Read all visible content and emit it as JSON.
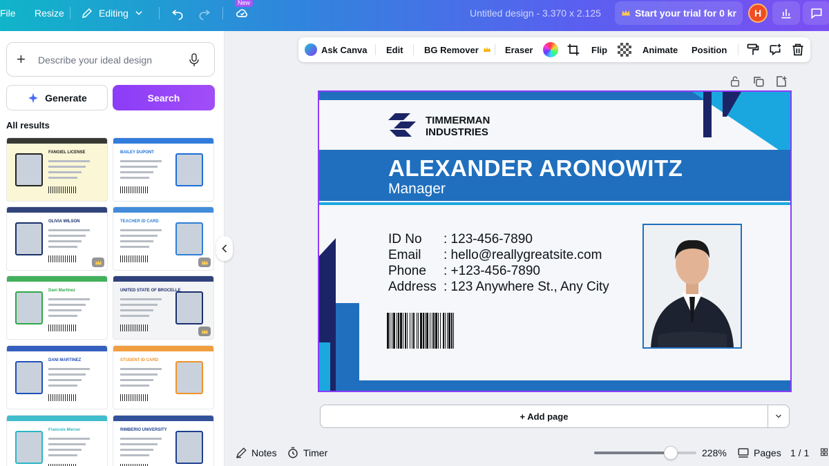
{
  "topbar": {
    "file": "File",
    "resize": "Resize",
    "editing": "Editing",
    "new_badge": "New",
    "doc_title": "Untitled design - 3.370 x 2.125",
    "trial": "Start your trial for 0 kr",
    "avatar_letter": "H"
  },
  "sidebar": {
    "search_placeholder": "Describe your ideal design",
    "generate": "Generate",
    "search": "Search",
    "results_label": "All results",
    "thumbs": [
      {
        "title": "FANGIEL LICENSE",
        "bg": "#fbf7d6",
        "accent": "#222222"
      },
      {
        "title": "BAILEY DUPONT",
        "bg": "#ffffff",
        "accent": "#1c6ed8"
      },
      {
        "title": "OLIVIA WILSON",
        "bg": "#ffffff",
        "accent": "#1a2f6b"
      },
      {
        "title": "TEACHER ID CARD",
        "bg": "#ffffff",
        "accent": "#2d7fd6"
      },
      {
        "title": "Dani Martinez",
        "bg": "#ffffff",
        "accent": "#2fa84a"
      },
      {
        "title": "UNITED STATE OF BROCELLE",
        "bg": "#f3f4f6",
        "accent": "#1b2f6e"
      },
      {
        "title": "DANI MARTINEZ",
        "bg": "#ffffff",
        "accent": "#1f4fb8"
      },
      {
        "title": "STUDENT ID CARD",
        "bg": "#ffffff",
        "accent": "#f0932b"
      },
      {
        "title": "Francois Mercer",
        "bg": "#ffffff",
        "accent": "#2bb6c6"
      },
      {
        "title": "RIMBERIO UNIVERSITY",
        "bg": "#ffffff",
        "accent": "#1d3f8f"
      }
    ]
  },
  "context_toolbar": {
    "ask_canva": "Ask Canva",
    "edit": "Edit",
    "bg_remover": "BG Remover",
    "eraser": "Eraser",
    "flip": "Flip",
    "animate": "Animate",
    "position": "Position"
  },
  "card": {
    "company_line1": "TIMMERMAN",
    "company_line2": "INDUSTRIES",
    "name": "ALEXANDER ARONOWITZ",
    "role": "Manager",
    "fields": [
      {
        "label": "ID No",
        "value": ": 123-456-7890"
      },
      {
        "label": "Email",
        "value": ": hello@reallygreatsite.com"
      },
      {
        "label": "Phone",
        "value": ": +123-456-7890"
      },
      {
        "label": "Address",
        "value": ": 123 Anywhere St., Any City"
      }
    ],
    "colors": {
      "navy": "#1b2466",
      "blue": "#1f6fbe",
      "cyan": "#1aa7e0"
    }
  },
  "canvas": {
    "add_page": "+ Add page"
  },
  "bottombar": {
    "notes": "Notes",
    "timer": "Timer",
    "zoom": "228%",
    "zoom_fraction": 0.75,
    "pages": "Pages",
    "page_count": "1 / 1"
  }
}
